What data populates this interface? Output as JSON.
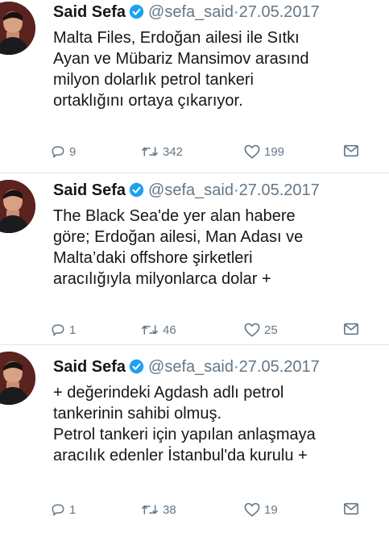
{
  "tweets": [
    {
      "name": "Said Sefa",
      "handle": "@sefa_said",
      "separator": "·",
      "date": "27.05.2017",
      "lines": [
        "Malta Files, Erdoğan ailesi ile Sıtkı",
        "Ayan ve Mübariz Mansimov arasınd",
        "milyon dolarlık petrol tankeri",
        "ortaklığını ortaya çıkarıyor."
      ],
      "replies": "9",
      "retweets": "342",
      "likes": "199"
    },
    {
      "name": "Said Sefa",
      "handle": "@sefa_said",
      "separator": "·",
      "date": "27.05.2017",
      "lines": [
        "The Black Sea'de yer alan habere",
        "göre; Erdoğan ailesi, Man Adası ve",
        "Malta’daki offshore şirketleri",
        "aracılığıyla milyonlarca dolar +"
      ],
      "replies": "1",
      "retweets": "46",
      "likes": "25"
    },
    {
      "name": "Said Sefa",
      "handle": "@sefa_said",
      "separator": "·",
      "date": "27.05.2017",
      "lines": [
        "+ değerindeki Agdash adlı petrol",
        "tankerinin sahibi olmuş.",
        "Petrol tankeri için yapılan anlaşmaya",
        "aracılık edenler İstanbul'da kurulu +"
      ],
      "replies": "1",
      "retweets": "38",
      "likes": "19"
    }
  ],
  "icons": {
    "reply": "reply-icon",
    "retweet": "retweet-icon",
    "like": "heart-icon",
    "dm": "envelope-icon",
    "verified": "verified-badge-icon",
    "avatar": "profile-photo"
  },
  "colors": {
    "text": "#14171a",
    "muted": "#657786",
    "verified": "#1da1f2",
    "divider": "#e1e8ed"
  }
}
